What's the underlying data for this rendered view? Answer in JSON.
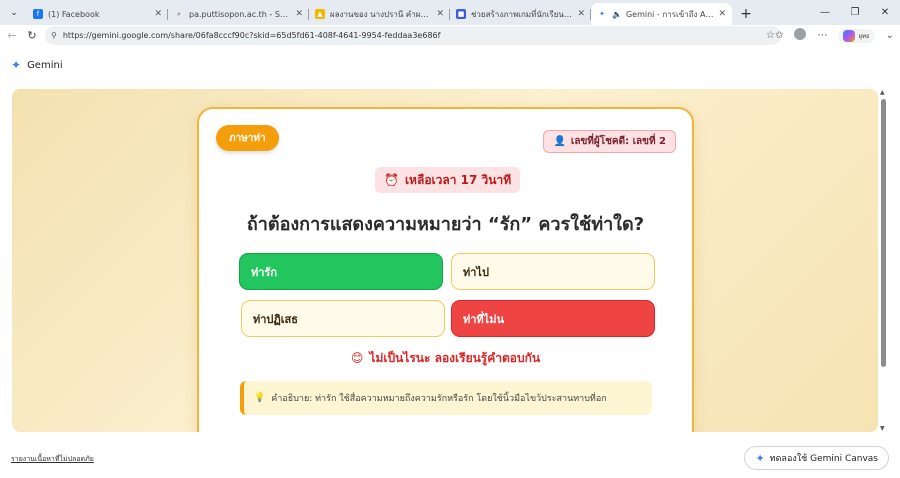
{
  "browser": {
    "tabs": [
      {
        "title": "(1) Facebook",
        "favicon": "facebook-icon",
        "color": "#1877f2",
        "glyph": "f"
      },
      {
        "title": "pa.puttisopon.ac.th - Search",
        "favicon": "search-icon",
        "color": "#9aa0a6",
        "glyph": "🔍"
      },
      {
        "title": "ผลงานของ นางปรานี คำผล - โรงเรียนพุทธิโสภณ",
        "favicon": "drive-icon",
        "color": "#f4b400",
        "glyph": "▲"
      },
      {
        "title": "ช่วยสร้างภาพเกมที่นักเรียนชั้นเรียน",
        "favicon": "app-icon",
        "color": "#3b5bdb",
        "glyph": "■"
      },
      {
        "title": "Gemini - การเข้าถึง AI ของ Google",
        "favicon": "gemini-icon",
        "color": "#3f7df1",
        "glyph": "✦",
        "active": true
      }
    ],
    "url": "https://gemini.google.com/share/06fa8cccf90c?skid=65d5fd61-408f-4641-9954-feddaa3e686f",
    "profile_label": "ยุทธ"
  },
  "header": {
    "app_name": "Gemini"
  },
  "game": {
    "lang_button": "ภาษาท่า",
    "player_badge": "เลขที่ผู้โชคดี: เลขที่ 2",
    "timer": "เหลือเวลา 17 วินาที",
    "question": "ถ้าต้องการแสดงความหมายว่า “รัก” ควรใช้ท่าใด?",
    "options": [
      {
        "label": "ท่ารัก",
        "state": "correct"
      },
      {
        "label": "ท่าไป",
        "state": "neutral"
      },
      {
        "label": "ท่าปฏิเสธ",
        "state": "neutral"
      },
      {
        "label": "ท่าที่ไม่น",
        "state": "wrong"
      }
    ],
    "feedback": "ไม่เป็นไรนะ ลองเรียนรู้คำตอบกัน",
    "explanation": "คำอธิบาย: ท่ารัก ใช้สื่อความหมายถึงความรักหรือรัก โดยใช้นิ้วมือไขว้ประสานทาบที่อก"
  },
  "footer": {
    "report_link": "รายงานเนื้อหาที่ไม่ปลอดภัย",
    "canvas_button": "ทดลองใช้ Gemini Canvas"
  },
  "colors": {
    "accent": "#f59e0b",
    "correct": "#22c55e",
    "wrong": "#ef4444"
  }
}
